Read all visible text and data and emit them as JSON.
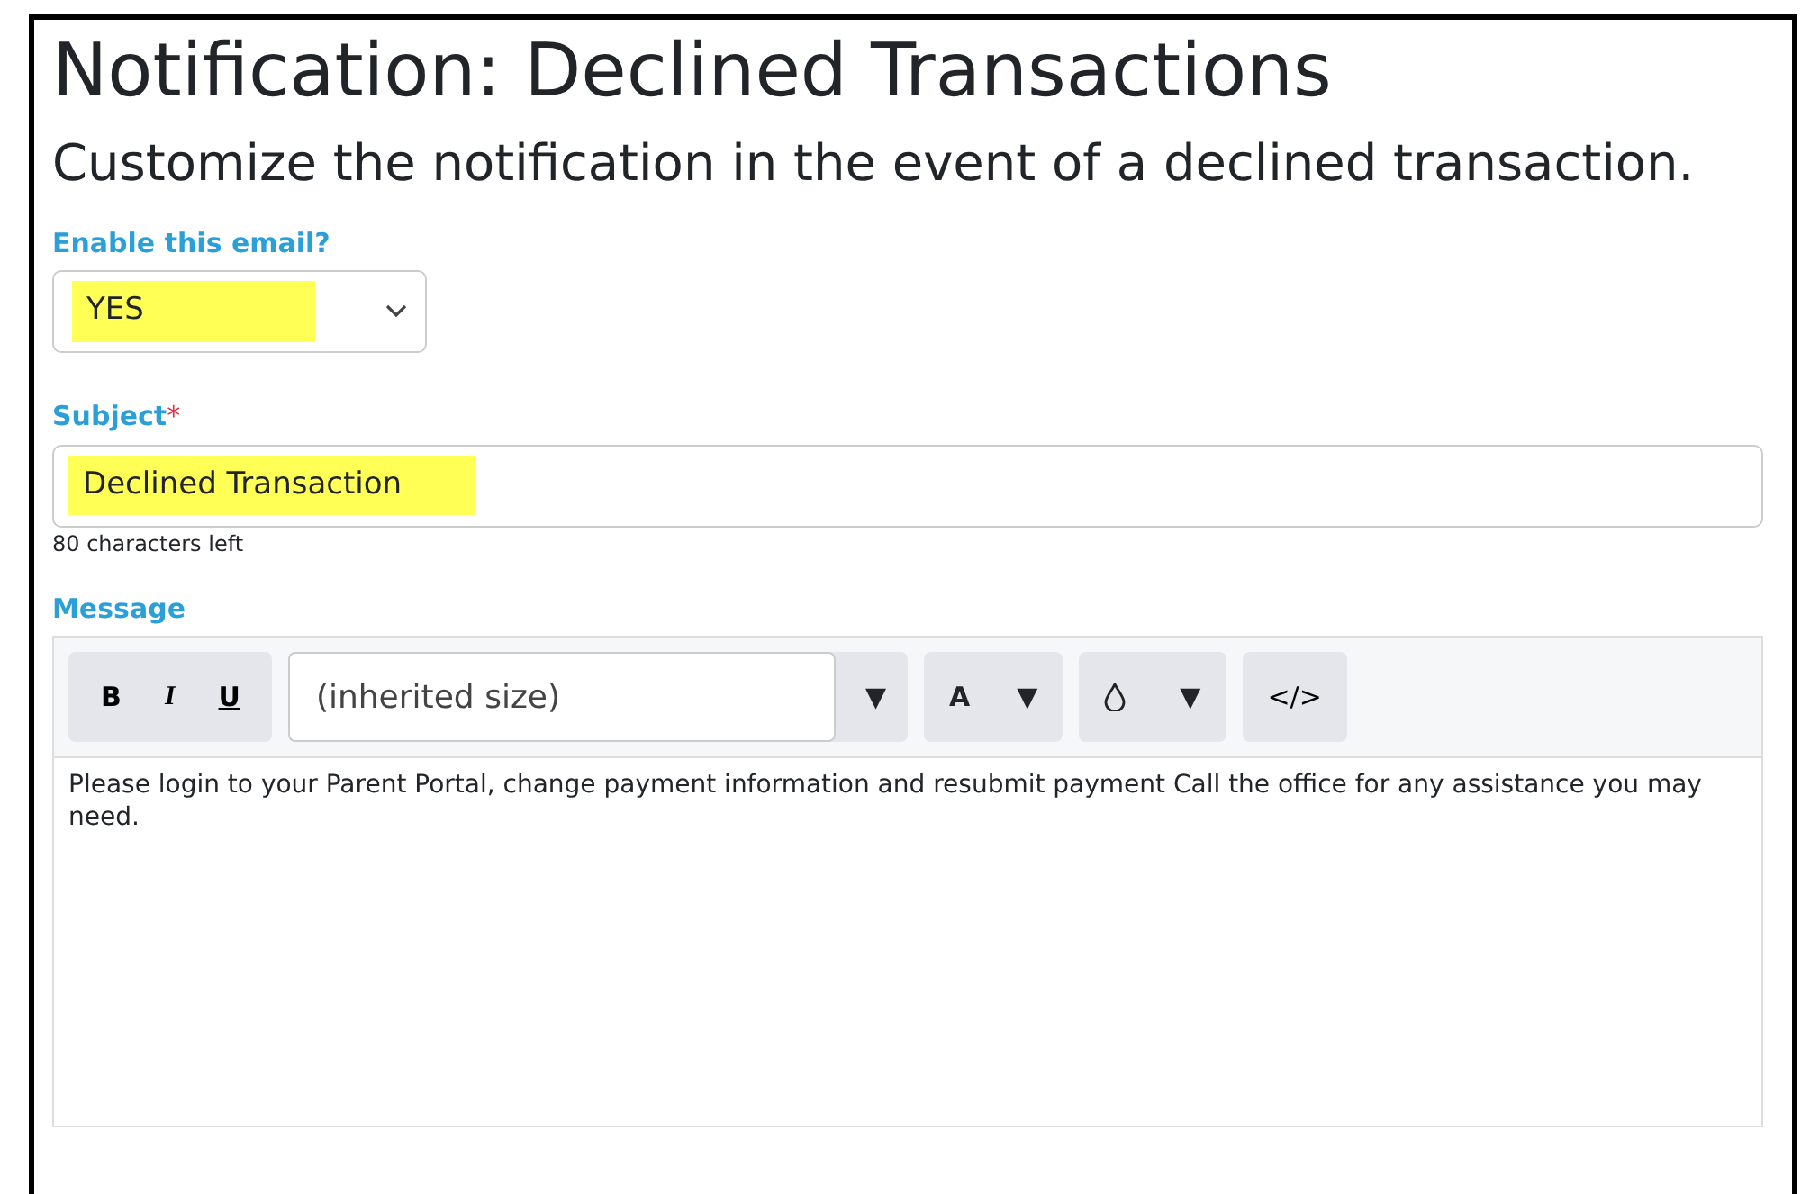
{
  "title": "Notification: Declined Transactions",
  "subtitle": "Customize the notification in the event of a declined transaction.",
  "enable_field": {
    "label": "Enable this email?",
    "value": "YES",
    "highlighted": true
  },
  "subject_field": {
    "label": "Subject",
    "required_mark": "*",
    "value": "Declined Transaction",
    "highlighted": true,
    "hint": "80 characters left"
  },
  "message_field": {
    "label": "Message",
    "toolbar": [
      {
        "kind": "format",
        "labels": [
          "B",
          "I",
          "U"
        ]
      },
      {
        "kind": "size",
        "value": "(inherited size)",
        "caret": "▼"
      },
      {
        "kind": "color",
        "label": "A",
        "caret": "▼"
      },
      {
        "kind": "fill",
        "caret": "▼"
      },
      {
        "kind": "code",
        "label": "</>"
      }
    ],
    "body": "Please login to your Parent Portal, change payment information and resubmit payment Call the office for any assistance you may need."
  }
}
